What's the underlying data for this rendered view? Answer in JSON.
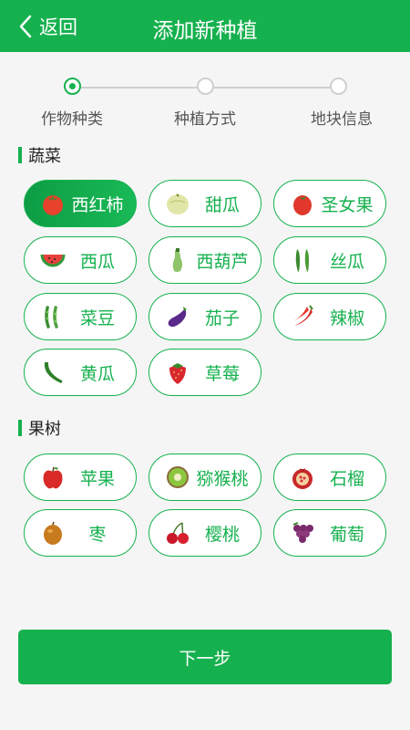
{
  "header": {
    "back_label": "返回",
    "title": "添加新种植"
  },
  "steps": [
    {
      "label": "作物种类",
      "active": true
    },
    {
      "label": "种植方式",
      "active": false
    },
    {
      "label": "地块信息",
      "active": false
    }
  ],
  "sections": [
    {
      "title": "蔬菜",
      "items": [
        {
          "label": "西红柿",
          "icon": "tomato-icon",
          "selected": true
        },
        {
          "label": "甜瓜",
          "icon": "melon-icon"
        },
        {
          "label": "圣女果",
          "icon": "cherry-tomato-icon"
        },
        {
          "label": "西瓜",
          "icon": "watermelon-icon"
        },
        {
          "label": "西葫芦",
          "icon": "zucchini-icon"
        },
        {
          "label": "丝瓜",
          "icon": "loofah-icon"
        },
        {
          "label": "菜豆",
          "icon": "bean-icon"
        },
        {
          "label": "茄子",
          "icon": "eggplant-icon"
        },
        {
          "label": "辣椒",
          "icon": "chili-icon"
        },
        {
          "label": "黄瓜",
          "icon": "cucumber-icon"
        },
        {
          "label": "草莓",
          "icon": "strawberry-icon"
        }
      ]
    },
    {
      "title": "果树",
      "items": [
        {
          "label": "苹果",
          "icon": "apple-icon"
        },
        {
          "label": "猕猴桃",
          "icon": "kiwi-icon"
        },
        {
          "label": "石榴",
          "icon": "pomegranate-icon"
        },
        {
          "label": "枣",
          "icon": "jujube-icon"
        },
        {
          "label": "樱桃",
          "icon": "cherry-icon"
        },
        {
          "label": "葡萄",
          "icon": "grape-icon"
        }
      ]
    }
  ],
  "footer": {
    "next_label": "下一步"
  },
  "colors": {
    "primary": "#16b14f",
    "background": "#f5f5f5",
    "step_inactive": "#cfcfcf"
  }
}
